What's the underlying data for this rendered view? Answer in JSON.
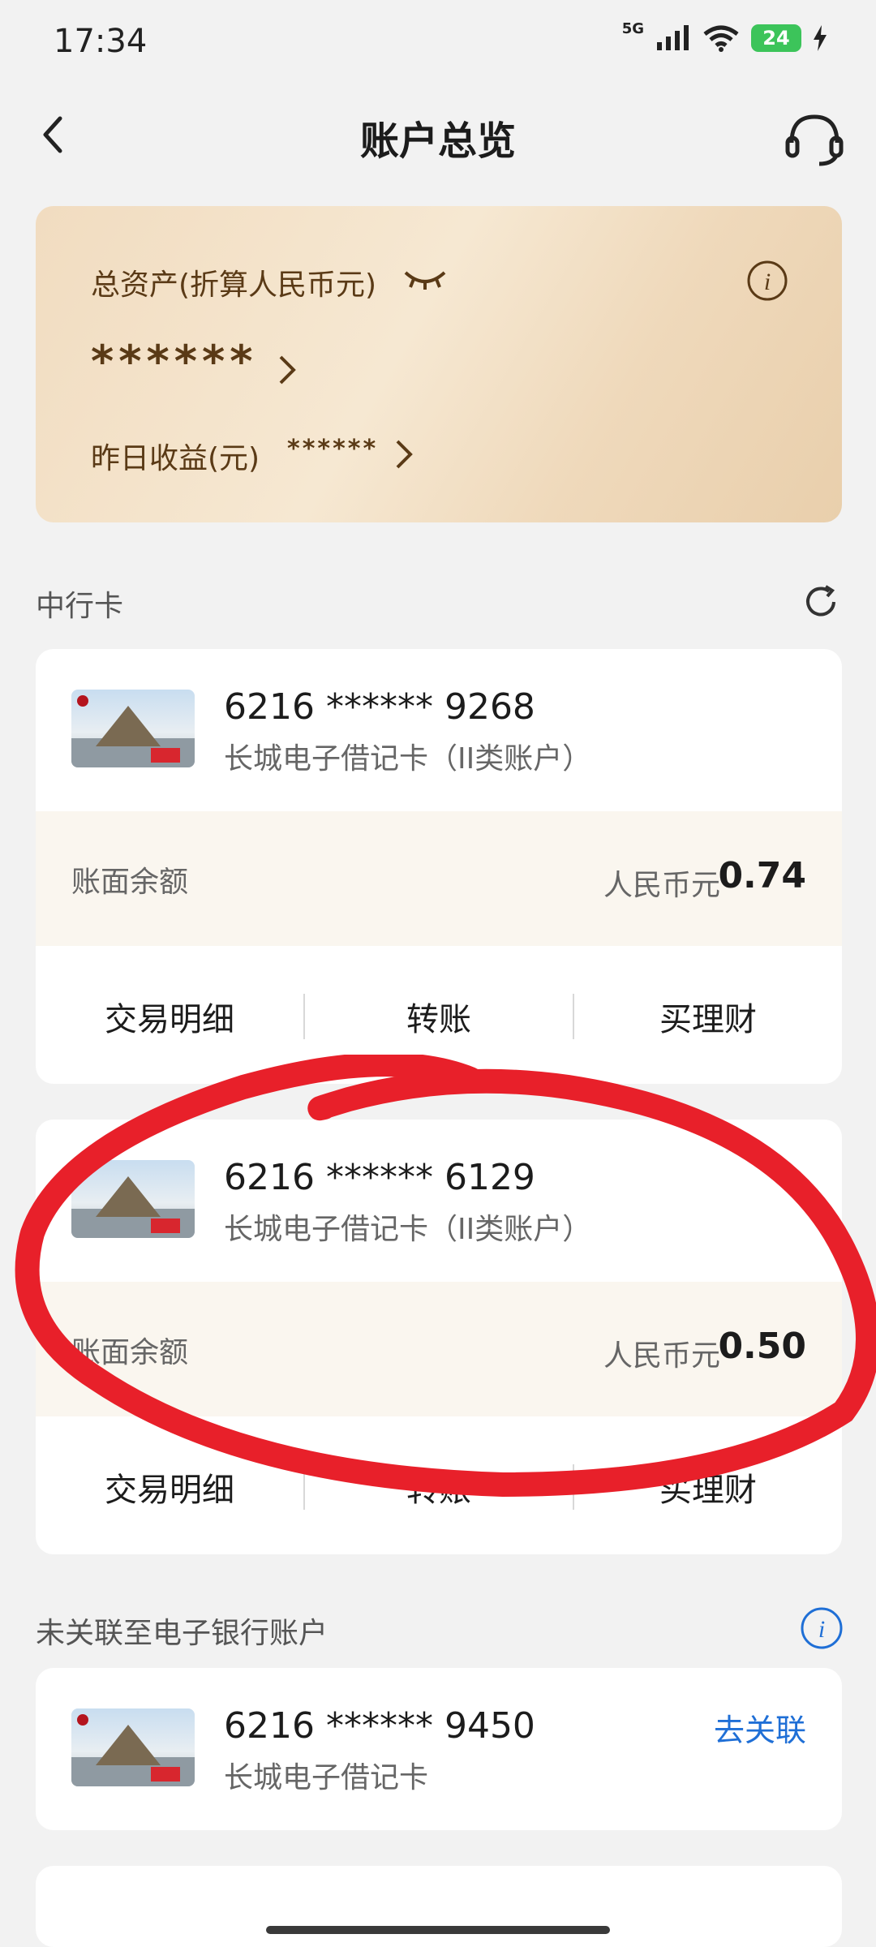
{
  "status_bar": {
    "time": "17:34",
    "network": "5G",
    "battery": "24"
  },
  "header": {
    "title": "账户总览",
    "back_icon": "chevron-left-icon",
    "service_icon": "headset-icon"
  },
  "asset_card": {
    "label": "总资产(折算人民币元)",
    "value": "******",
    "yesterday_label": "昨日收益(元)",
    "yesterday_value": "******"
  },
  "boc_section": {
    "title": "中行卡",
    "accounts": [
      {
        "number": "6216 ****** 9268",
        "type": "长城电子借记卡（II类账户）",
        "balance_label": "账面余额",
        "currency": "人民币元",
        "balance": "0.74",
        "actions": [
          "交易明细",
          "转账",
          "买理财"
        ]
      },
      {
        "number": "6216 ****** 6129",
        "type": "长城电子借记卡（II类账户）",
        "balance_label": "账面余额",
        "currency": "人民币元",
        "balance": "0.50",
        "actions": [
          "交易明细",
          "转账",
          "买理财"
        ]
      }
    ]
  },
  "unlinked_section": {
    "title": "未关联至电子银行账户",
    "account": {
      "number": "6216 ****** 9450",
      "type": "长城电子借记卡",
      "link_label": "去关联"
    }
  },
  "colors": {
    "accent": "#1f6fd6",
    "brand_text": "#5a3a16",
    "annotation": "#e8202a"
  }
}
